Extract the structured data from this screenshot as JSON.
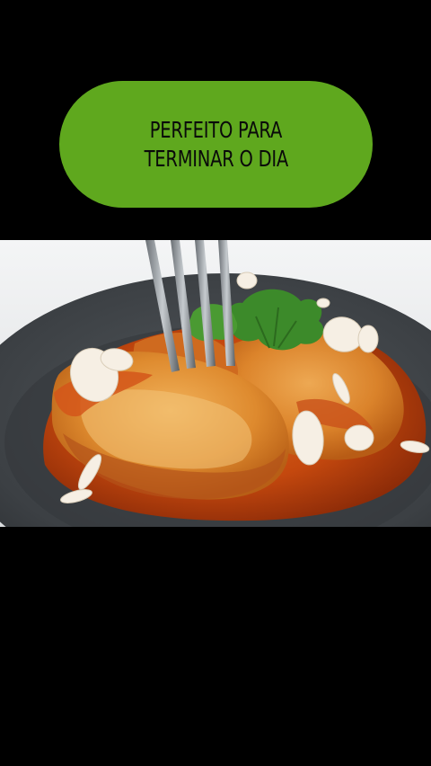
{
  "banner": {
    "line1": "PERFEITO PARA",
    "line2": "TERMINAR O DIA",
    "background_color": "#5fa81e",
    "text_color": "#0a0a0a"
  },
  "video_frame": {
    "subject": "food-photo-icon",
    "background_color": "#000000"
  }
}
